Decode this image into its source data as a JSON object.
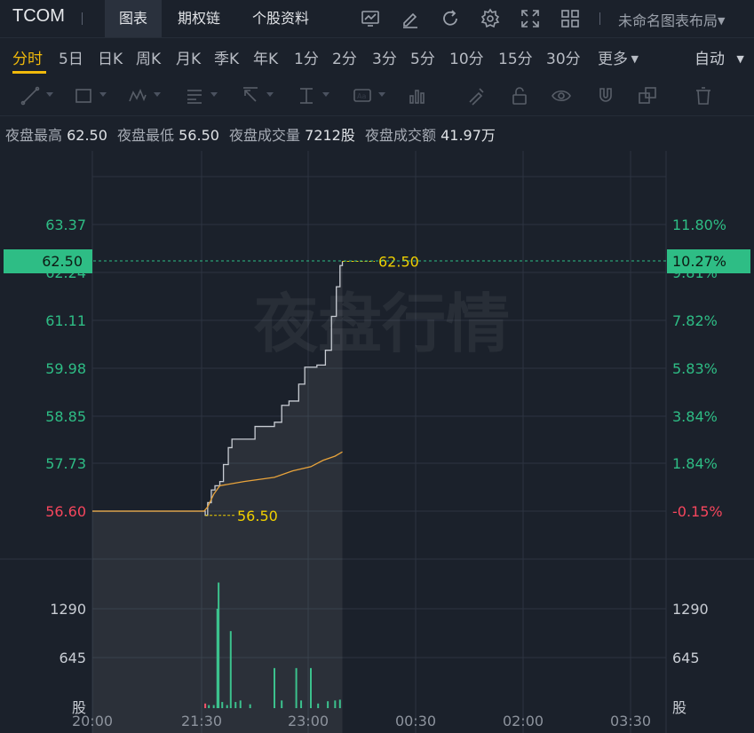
{
  "header": {
    "ticker": "TCOM",
    "tabs": [
      {
        "label": "图表",
        "active": true
      },
      {
        "label": "期权链",
        "active": false
      },
      {
        "label": "个股资料",
        "active": false
      }
    ],
    "icons": [
      "indicator-icon",
      "draw-edit-icon",
      "refresh-icon",
      "settings-icon",
      "fullscreen-icon",
      "layout-grid-icon"
    ],
    "layout_label": "未命名图表布局"
  },
  "periods": [
    "分时",
    "5日",
    "日K",
    "周K",
    "月K",
    "季K",
    "年K",
    "1分",
    "2分",
    "3分",
    "5分",
    "10分",
    "15分",
    "30分",
    "更多"
  ],
  "active_period": "分时",
  "scale_mode": "自动",
  "drawing_tools": [
    "trend-line-icon",
    "rectangle-icon",
    "pattern-icon",
    "fib-icon",
    "arrow-icon",
    "range-icon",
    "text-note-icon",
    "measure-icon",
    "brush-icon",
    "lock-icon",
    "eye-icon",
    "magnet-icon",
    "clone-icon",
    "trash-icon"
  ],
  "info": {
    "high_label": "夜盘最高",
    "high_value": "62.50",
    "low_label": "夜盘最低",
    "low_value": "56.50",
    "volume_label": "夜盘成交量",
    "volume_value": "7212股",
    "amount_label": "夜盘成交额",
    "amount_value": "41.97万"
  },
  "watermark": "夜盘行情",
  "colors": {
    "up": "#2ebd85",
    "down": "#f6465d",
    "avg_line": "#e8a33b",
    "price_line": "#c8ccd3",
    "marker": "#f0d000"
  },
  "chart_data": {
    "type": "line",
    "x_ticks": [
      "20:00",
      "21:30",
      "23:00",
      "00:30",
      "02:00",
      "03:30"
    ],
    "price_axis_left": [
      "63.37",
      "62.24",
      "61.11",
      "59.98",
      "58.85",
      "57.73",
      "56.60"
    ],
    "pct_axis_right": [
      "11.80%",
      "9.81%",
      "7.82%",
      "5.83%",
      "3.84%",
      "1.84%",
      "-0.15%"
    ],
    "current_price": "62.50",
    "current_pct": "10.27%",
    "high_marker": "62.50",
    "low_marker": "56.50",
    "volume_axis": [
      "1290",
      "645",
      "股"
    ],
    "ylim": [
      56.05,
      64.2
    ],
    "price_series": [
      [
        "20:00",
        56.6
      ],
      [
        "21:32",
        56.6
      ],
      [
        "21:33",
        56.5
      ],
      [
        "21:35",
        56.8
      ],
      [
        "21:38",
        57.1
      ],
      [
        "21:41",
        57.2
      ],
      [
        "21:45",
        57.3
      ],
      [
        "21:48",
        57.7
      ],
      [
        "21:52",
        58.1
      ],
      [
        "21:55",
        58.3
      ],
      [
        "22:05",
        58.3
      ],
      [
        "22:10",
        58.3
      ],
      [
        "22:14",
        58.6
      ],
      [
        "22:30",
        58.7
      ],
      [
        "22:36",
        59.1
      ],
      [
        "22:42",
        59.2
      ],
      [
        "22:50",
        59.6
      ],
      [
        "22:55",
        60.0
      ],
      [
        "23:05",
        60.05
      ],
      [
        "23:12",
        60.4
      ],
      [
        "23:17",
        61.2
      ],
      [
        "23:21",
        61.9
      ],
      [
        "23:24",
        62.4
      ],
      [
        "23:26",
        62.5
      ]
    ],
    "avg_series": [
      [
        "20:00",
        56.6
      ],
      [
        "21:32",
        56.6
      ],
      [
        "21:35",
        56.7
      ],
      [
        "21:40",
        57.0
      ],
      [
        "21:45",
        57.2
      ],
      [
        "21:55",
        57.25
      ],
      [
        "22:05",
        57.3
      ],
      [
        "22:30",
        57.4
      ],
      [
        "22:45",
        57.55
      ],
      [
        "23:00",
        57.65
      ],
      [
        "23:10",
        57.8
      ],
      [
        "23:20",
        57.9
      ],
      [
        "23:26",
        58.0
      ]
    ],
    "volume_series": [
      [
        "21:33",
        60,
        "down"
      ],
      [
        "21:36",
        40,
        "up"
      ],
      [
        "21:40",
        40,
        "up"
      ],
      [
        "21:43",
        1290,
        "up"
      ],
      [
        "21:44",
        1630,
        "up"
      ],
      [
        "21:47",
        80,
        "up"
      ],
      [
        "21:51",
        40,
        "up"
      ],
      [
        "21:54",
        1000,
        "up"
      ],
      [
        "21:58",
        80,
        "up"
      ],
      [
        "22:02",
        100,
        "up"
      ],
      [
        "22:10",
        50,
        "up"
      ],
      [
        "22:30",
        520,
        "up"
      ],
      [
        "22:36",
        100,
        "up"
      ],
      [
        "22:48",
        520,
        "up"
      ],
      [
        "22:52",
        100,
        "up"
      ],
      [
        "23:00",
        520,
        "up"
      ],
      [
        "23:06",
        60,
        "up"
      ],
      [
        "23:14",
        90,
        "up"
      ],
      [
        "23:20",
        100,
        "up"
      ],
      [
        "23:24",
        110,
        "up"
      ]
    ],
    "volume_max": 1935
  }
}
